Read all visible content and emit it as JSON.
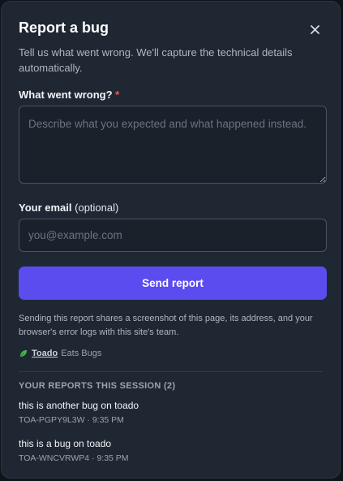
{
  "modal": {
    "title": "Report a bug",
    "subtitle": "Tell us what went wrong. We'll capture the technical details automatically.",
    "close_icon": "close-icon"
  },
  "form": {
    "description_label": "What went wrong?",
    "required_mark": "*",
    "description_placeholder": "Describe what you expected and what happened instead.",
    "description_value": "",
    "email_label": "Your email",
    "email_optional": "(optional)",
    "email_placeholder": "you@example.com",
    "email_value": "",
    "submit_label": "Send report"
  },
  "disclaimer": "Sending this report shares a screenshot of this page, its address, and your browser's error logs with this site's team.",
  "brand": {
    "icon": "leaf-icon",
    "link_text": "Toado",
    "suffix": "Eats Bugs"
  },
  "reports": {
    "heading": "Your reports this session (2)",
    "items": [
      {
        "title": "this is another bug on toado",
        "meta": "TOA-PGPY9L3W · 9:35 PM"
      },
      {
        "title": "this is a bug on toado",
        "meta": "TOA-WNCVRWP4 · 9:35 PM"
      }
    ]
  },
  "colors": {
    "accent": "#5b4cf0",
    "modal_bg": "#1f2733",
    "required": "#ef5a5a",
    "brand_leaf": "#4caf50"
  }
}
